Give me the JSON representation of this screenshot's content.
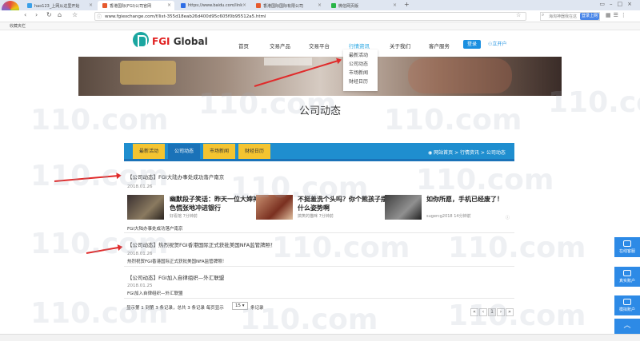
{
  "browser": {
    "tabs": [
      {
        "label": "hao123_上网从这里开始",
        "color": "#3aa0e8"
      },
      {
        "label": "香港国际(FGI)公司官网",
        "color": "#e65a2e"
      },
      {
        "label": "https://www.baidu.com/link",
        "color": "#2e6de6"
      },
      {
        "label": "香港国际国际有限公司",
        "color": "#e65a2e"
      },
      {
        "label": "微信网页版",
        "color": "#2ab547"
      }
    ],
    "url": "www.fgiexchange.com/f/list-355d18eab26d400d95c605f0b95512a5.html",
    "search_placeholder": "海淘神器我在这",
    "login": "登录上网",
    "bookmarks": "收藏夹栏"
  },
  "site": {
    "logo_text_fgi": "FGI",
    "logo_text_global": "Global",
    "nav": [
      "首页",
      "交易产品",
      "交易平台",
      "行情资讯",
      "关于我们",
      "客户服务"
    ],
    "register": "登录",
    "open_account": "立开户",
    "dropdown": [
      "最新活动",
      "公司动态",
      "市场新闻",
      "财经日历"
    ]
  },
  "page": {
    "title": "公司动态",
    "subnav": [
      "最新活动",
      "公司动态",
      "市场新闻",
      "财经日历"
    ],
    "breadcrumb": "网站首页 > 行情资讯 > 公司动态"
  },
  "articles": [
    {
      "title": "【公司动态】FGI大陆办事处成功落户南京",
      "date": "2018.01.26",
      "desc": "FGI大陆办事处成功落户南京"
    },
    {
      "title": "【公司动态】热烈祝贺FGI香港国际正式获批美国NFA监管牌照！",
      "date": "2018.01.26",
      "desc": "热烈祝贺FGI香港国际正式获批美国NFA监管牌照！"
    },
    {
      "title": "【公司动态】FGI加入自律组织—外汇联盟",
      "date": "2018.01.25",
      "desc": "FGI加入自律组织—外汇联盟"
    }
  ],
  "ad_cards": [
    {
      "title_line1": "幽默段子笑话：昨天一位大婶神",
      "title_line2": "色慌张地冲进银行",
      "meta": "好看馆 7分钟前"
    },
    {
      "title_line1": "不挺羞洗个头吗？你个熊孩子摆",
      "title_line2": "什么姿势啊",
      "meta": "搞笑的猫咪 7分钟前"
    },
    {
      "title_line1": "如你所愿，手机已经废了！",
      "title_line2": "",
      "meta": "sugercg2018 14分钟前"
    }
  ],
  "pagination": {
    "info": "显示第 1 到第 3 条记录，总共 3 条记录 每页显示",
    "per_page": "15",
    "tail": "条记录",
    "buttons": [
      "«",
      "‹",
      "1",
      "›",
      "»"
    ]
  },
  "side_widgets": [
    "在线客服",
    "真实账户",
    "模拟账户"
  ],
  "watermark": "110.com"
}
